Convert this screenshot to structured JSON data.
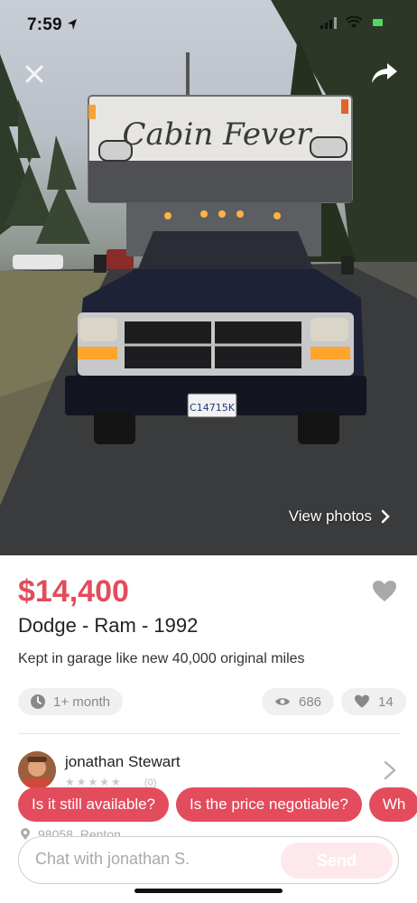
{
  "status_bar": {
    "time": "7:59"
  },
  "hero": {
    "truck_sign": "Cabin Fever",
    "plate": "C14715K",
    "view_photos_label": "View photos"
  },
  "listing": {
    "price": "$14,400",
    "title": "Dodge - Ram - 1992",
    "description": "Kept in garage like new 40,000 original miles",
    "age": "1+ month",
    "views": "686",
    "likes": "14"
  },
  "seller": {
    "name": "jonathan Stewart",
    "rating_count": "(0)",
    "location": "98058, Renton"
  },
  "quick_replies": [
    "Is it still available?",
    "Is the price negotiable?",
    "Wh"
  ],
  "chat": {
    "placeholder": "Chat with jonathan S.",
    "send_label": "Send"
  },
  "colors": {
    "accent": "#e34c5d",
    "pill_bg": "#f0f0f0"
  },
  "icons": [
    "location-arrow-icon",
    "signal-icon",
    "wifi-icon",
    "battery-icon",
    "close-icon",
    "share-icon",
    "chevron-right-icon",
    "heart-icon",
    "clock-icon",
    "eye-icon",
    "pin-icon"
  ]
}
